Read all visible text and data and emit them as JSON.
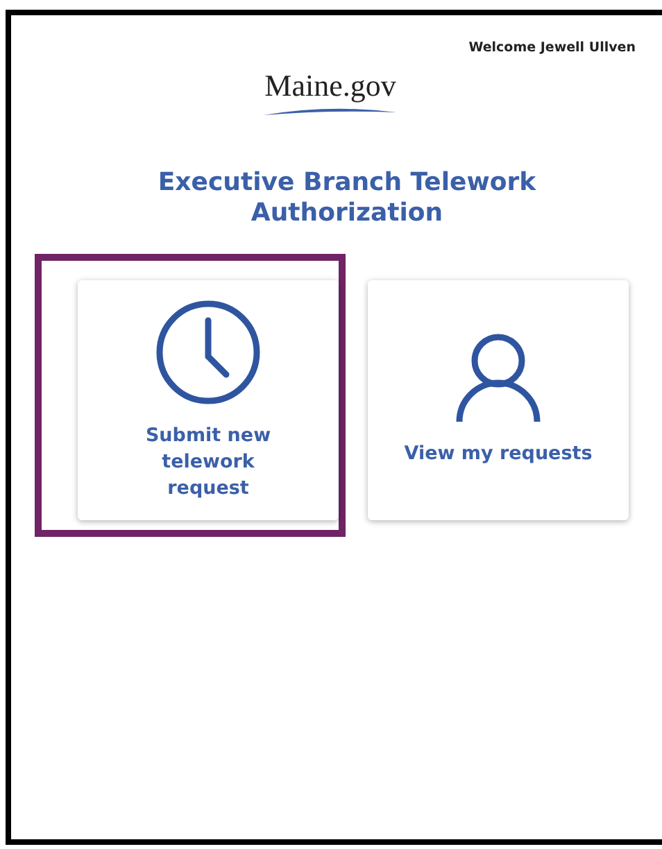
{
  "header": {
    "welcome": "Welcome Jewell Ullven",
    "logo": "Maine.gov"
  },
  "title": "Executive Branch Telework Authorization",
  "tiles": [
    {
      "kind": "clock",
      "label": "Submit new telework request",
      "highlighted": true
    },
    {
      "kind": "person",
      "label": "View my requests",
      "highlighted": false
    }
  ]
}
